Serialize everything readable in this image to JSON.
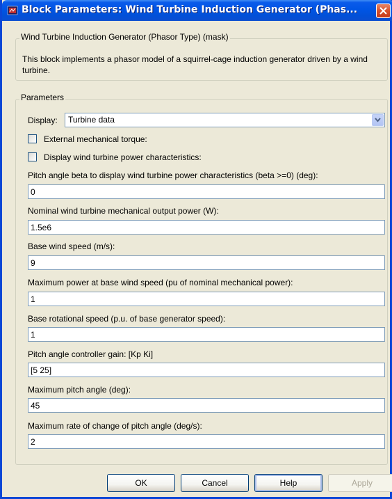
{
  "window": {
    "title": "Block Parameters: Wind Turbine Induction Generator (Phas..."
  },
  "mask": {
    "legend": "Wind Turbine Induction Generator (Phasor Type) (mask)",
    "description": "This block implements a phasor model of a squirrel-cage induction generator driven by a wind turbine."
  },
  "parameters": {
    "legend": "Parameters",
    "display_label": "Display:",
    "display_value": "Turbine data",
    "checkboxes": [
      {
        "label": "External mechanical torque:",
        "checked": false
      },
      {
        "label": "Display wind turbine power characteristics:",
        "checked": false
      }
    ],
    "fields": [
      {
        "label": "Pitch angle beta to display wind turbine power characteristics (beta >=0)  (deg):",
        "value": "0"
      },
      {
        "label": "Nominal wind turbine mechanical output power (W):",
        "value": "1.5e6"
      },
      {
        "label": "Base wind speed (m/s):",
        "value": "9"
      },
      {
        "label": "Maximum power at base wind speed (pu of nominal mechanical power):",
        "value": "1"
      },
      {
        "label": "Base rotational speed (p.u. of base generator speed):",
        "value": "1"
      },
      {
        "label": "Pitch angle controller gain: [Kp Ki]",
        "value": "[5 25]"
      },
      {
        "label": "Maximum pitch angle (deg):",
        "value": "45"
      },
      {
        "label": "Maximum rate of change of pitch angle (deg/s):",
        "value": "2"
      }
    ]
  },
  "buttons": {
    "ok": "OK",
    "cancel": "Cancel",
    "help": "Help",
    "apply": "Apply"
  },
  "colors": {
    "titlebar": "#0055E5",
    "window_bg": "#ECE9D8",
    "close": "#D9512B",
    "input_border": "#7F9DB9"
  }
}
